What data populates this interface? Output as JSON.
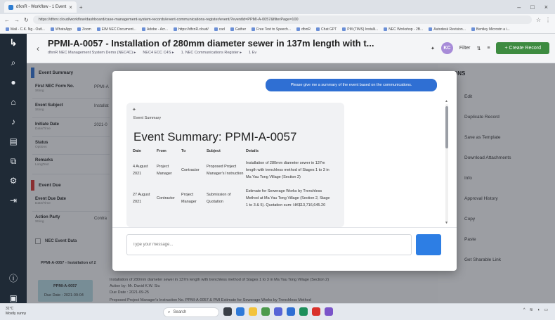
{
  "browser": {
    "tab_title": "dfxnR - Workflow - 1 Event",
    "url": "https://dfxnr.cloud/workflow/dashboard/case-management-system-records/event-communications-register/event/?eventId=PPMI-A-0057&filterPage=100",
    "bookmarks": [
      "Mail - C.K. Ng - Outl...",
      "WhatsApp",
      "Zoom",
      "EIM NEC Document...",
      "Adobe - Acr...",
      "https://dfxnR.cloud/",
      "cad",
      "Gather",
      "Free Text to Speech...",
      "dfxnR",
      "Chat GPT",
      "PM (TIMS) Installi...",
      "NEC Workshop - 2B...",
      "Autodesk Revision...",
      "Bentley Microstn a i..."
    ]
  },
  "sidebar": {
    "logo": "↳",
    "icons": [
      "search-icon",
      "user-icon",
      "home-icon",
      "bell-icon",
      "document-icon",
      "network-icon",
      "gear-icon",
      "logout-icon",
      "info-icon",
      "admin-icon"
    ]
  },
  "header": {
    "title": "PPMI-A-0057 - Installation of 280mm diameter sewer in 137m length with t...",
    "breadcrumbs": [
      "dfxnR NEC Management System Demo (NEC4C) ▸",
      "NEC4 ECC C4S ▸",
      "1. NEC Communications Register ▸",
      "1 Ev"
    ],
    "avatar_initials": "KC",
    "filter_label": "Filter",
    "create_label": "+ Create Record"
  },
  "form": {
    "event_summary_label": "Event Summary",
    "fields": [
      {
        "label": "First NEC Form No.",
        "type": "String",
        "value": "PPMI-A"
      },
      {
        "label": "Event Subject",
        "type": "String",
        "value": "Installat"
      },
      {
        "label": "Initiate Date",
        "type": "Date/Time",
        "value": "2021-0"
      },
      {
        "label": "Status",
        "type": "Options",
        "value": ""
      },
      {
        "label": "Remarks",
        "type": "LongText",
        "value": ""
      }
    ],
    "event_due_label": "Event Due",
    "due_fields": [
      {
        "label": "Event Due Date",
        "type": "Date/Time",
        "value": ""
      },
      {
        "label": "Action Party",
        "type": "String",
        "value": "Contra"
      }
    ],
    "nec_event_data_label": "NEC Event Data",
    "record_row_label": "PPMI-A-0057 - Installation of 2",
    "event_card": {
      "id": "PPMI-A-0057",
      "date": "Due Date : 2021-09-04"
    },
    "event_lines": [
      "Installation of 280mm diameter sewer in 137m length with trenchless method of Stages 1 to 3 in Ma Yau Tong Village (Section 2)",
      "Action by: Mr. David K.W. Siu",
      "Due Date : 2021-09-25",
      "Proposed Project Manager's Instruction No. PPMI-A-0057 & PMI Estimate for Sewerage Works by Trenchless Method"
    ]
  },
  "actions": {
    "heading": "ONS",
    "items": [
      "Edit",
      "Duplicate Record",
      "Save as Template",
      "Download Attachments",
      "Info",
      "Approval History",
      "Copy",
      "Paste",
      "Get Sharable Link"
    ]
  },
  "chat": {
    "user_message": "Please give me a summary of the event based on the communications.",
    "bot_small_label": "Event Summary",
    "bot_title": "Event Summary: PPMI-A-0057",
    "table_headers": [
      "Date",
      "From",
      "To",
      "Subject",
      "Details"
    ],
    "table_rows": [
      [
        "4 August 2021",
        "Project Manager",
        "Contractor",
        "Proposed Project Manager's Instruction",
        "Installation of 280mm diameter sewer in 137m length with trenchless method of Stages 1 to 3 in Ma Yau Tong Village (Section 2)"
      ],
      [
        "27 August 2021",
        "Contractor",
        "Project Manager",
        "Submission of Quotation",
        "Estimate for Sewerage Works by Trenchless Method at Ma Yau Tong Village (Section 2, Stage 1 to 3 & 5). Quotation sum: HK$13,716,645.20"
      ]
    ],
    "input_placeholder": "Type your message..."
  },
  "taskbar": {
    "weather_temp": "31°C",
    "weather_desc": "Mostly sunny",
    "search_label": "Search"
  },
  "colors": {
    "accent_blue": "#2f6fd3",
    "create_green": "#3d8b40",
    "event_due_red": "#d9312b",
    "sidebar_dark": "#1f2a36"
  }
}
